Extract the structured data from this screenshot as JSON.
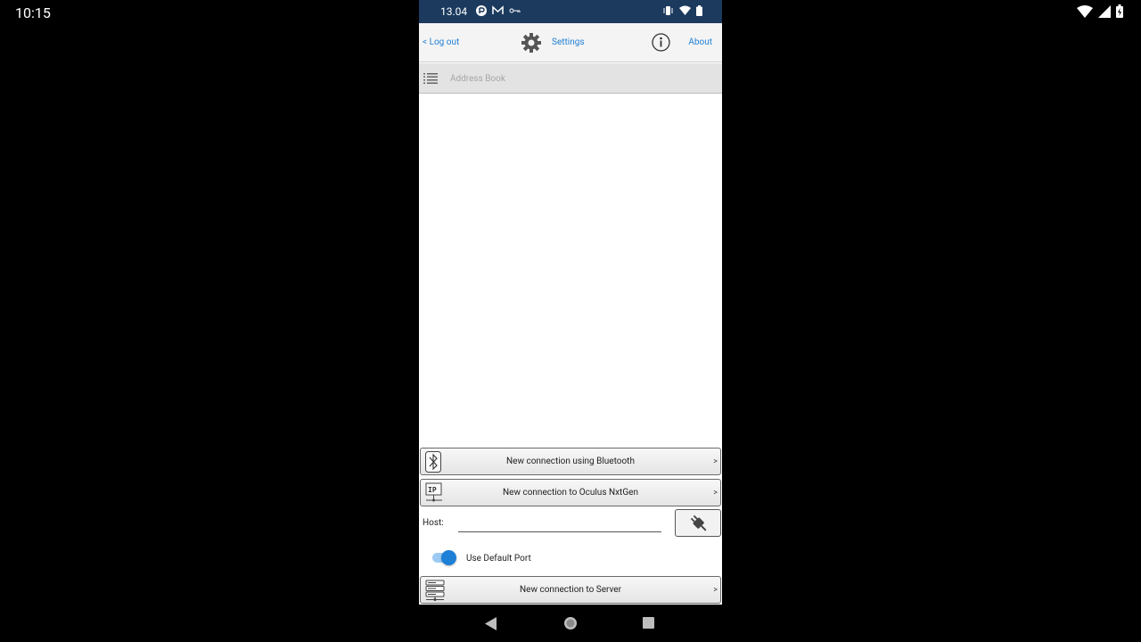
{
  "host_status": {
    "time": "10:15"
  },
  "phone_status": {
    "time": "13.04"
  },
  "toolbar": {
    "logout": "< Log out",
    "settings": "Settings",
    "about": "About"
  },
  "address_book": {
    "label": "Address Book"
  },
  "buttons": {
    "bluetooth": "New connection using Bluetooth",
    "oculus": "New connection to Oculus NxtGen",
    "server": "New connection to Server",
    "chevron": ">"
  },
  "host": {
    "label": "Host:",
    "value": "",
    "placeholder": ""
  },
  "default_port": {
    "label": "Use Default Port",
    "enabled": true
  },
  "colors": {
    "accent": "#1e7fd6",
    "statusbar": "#1c3a5e"
  }
}
